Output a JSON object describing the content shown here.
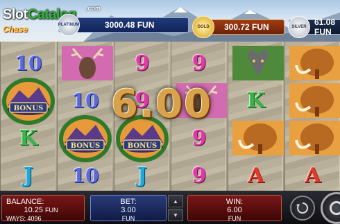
{
  "logo": {
    "brand_slot": "Slot",
    "brand_catalog": "Catalog",
    "domain": ".com",
    "game_word": "Chase"
  },
  "jackpots": {
    "platinum": {
      "label": "PLATINUM",
      "value": "3000.48 FUN"
    },
    "gold": {
      "label": "GOLD",
      "value": "300.72 FUN"
    },
    "silver": {
      "label": "SILVER",
      "value": "61.08 FUN"
    }
  },
  "reels": [
    [
      "10",
      "bonus",
      "K",
      "J"
    ],
    [
      "deer",
      "10",
      "bonus",
      "10"
    ],
    [
      "9",
      "9",
      "bonus",
      "J"
    ],
    [
      "9",
      "moose",
      "9",
      "9"
    ],
    [
      "wolf",
      "K",
      "mammoth",
      "A"
    ],
    [
      "mammoth",
      "mammoth",
      "mammoth",
      "A"
    ]
  ],
  "symbol_text": {
    "bonus": "BONUS"
  },
  "win_display": "6.00",
  "bottom": {
    "balance_label": "BALANCE:",
    "balance_value": "10.25",
    "balance_unit": "FUN",
    "ways_label": "WAYS:",
    "ways_value": "4096",
    "bet_label": "BET:",
    "bet_value": "3.00",
    "bet_unit": "FUN",
    "win_label": "WIN:",
    "win_value": "6.00",
    "win_unit": "FUN"
  },
  "colors": {
    "platinum": "#203a78",
    "gold": "#a03c12",
    "panel_red": "#7a1616",
    "bet_blue": "#2a3b7a",
    "win_text": "#d8a24a"
  }
}
